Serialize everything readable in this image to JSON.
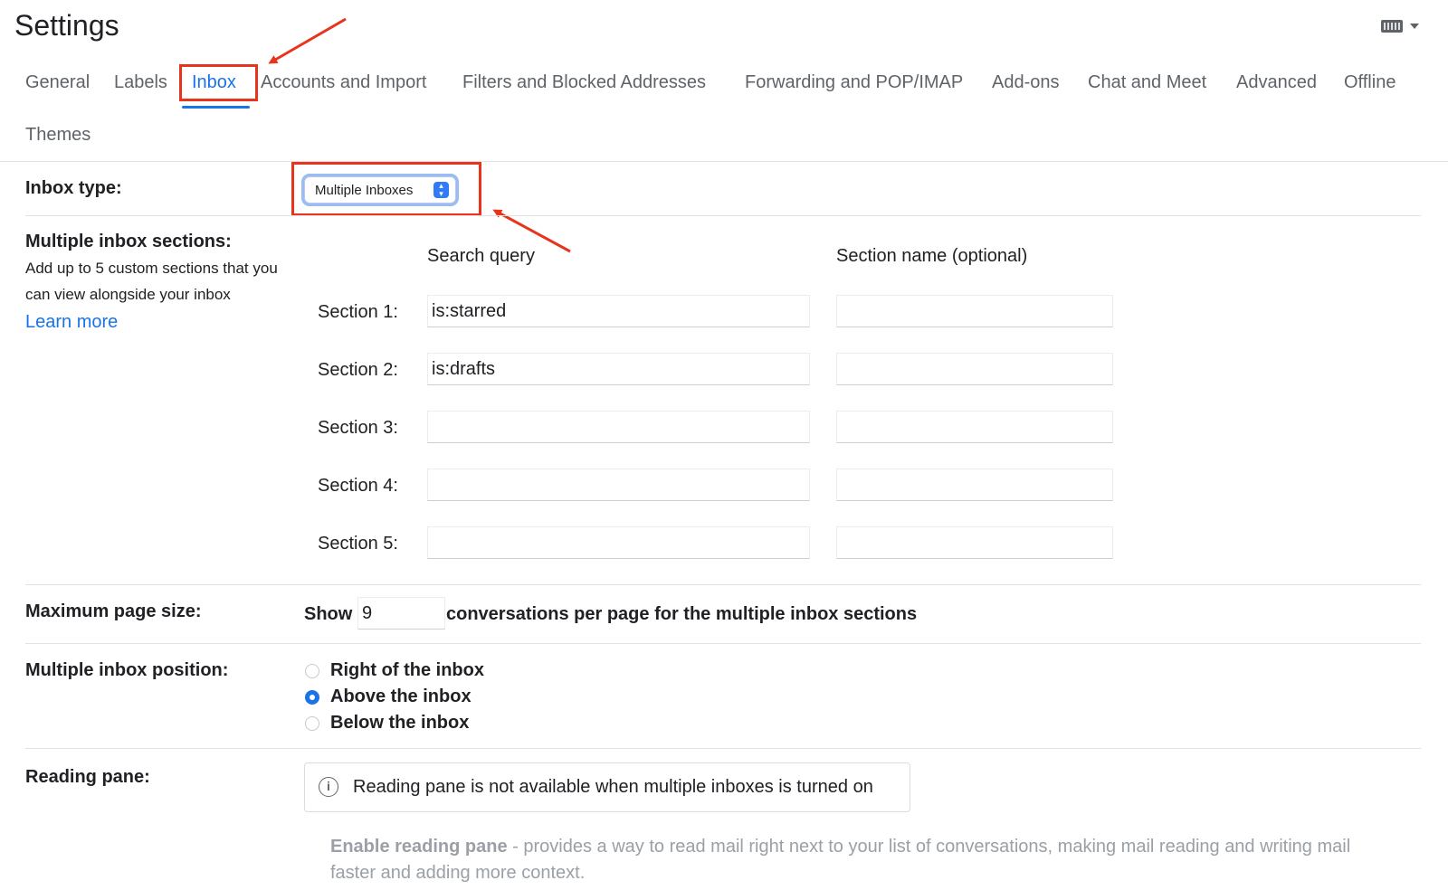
{
  "page": {
    "title": "Settings"
  },
  "keyboard": {
    "icon": "keyboard-icon"
  },
  "tabs": [
    {
      "label": "General"
    },
    {
      "label": "Labels"
    },
    {
      "label": "Inbox",
      "active": true
    },
    {
      "label": "Accounts and Import"
    },
    {
      "label": "Filters and Blocked Addresses"
    },
    {
      "label": "Forwarding and POP/IMAP"
    },
    {
      "label": "Add-ons"
    },
    {
      "label": "Chat and Meet"
    },
    {
      "label": "Advanced"
    },
    {
      "label": "Offline"
    },
    {
      "label": "Themes"
    }
  ],
  "inbox_type": {
    "label": "Inbox type:",
    "value": "Multiple Inboxes"
  },
  "multiple_sections": {
    "label": "Multiple inbox sections:",
    "desc_line1": "Add up to 5 custom sections that you",
    "desc_line2": "can view alongside your inbox",
    "learn_more": "Learn more",
    "search_header": "Search query",
    "name_header": "Section name (optional)",
    "sections": [
      {
        "label": "Section 1:",
        "query": "is:starred",
        "name": ""
      },
      {
        "label": "Section 2:",
        "query": "is:drafts",
        "name": ""
      },
      {
        "label": "Section 3:",
        "query": "",
        "name": ""
      },
      {
        "label": "Section 4:",
        "query": "",
        "name": ""
      },
      {
        "label": "Section 5:",
        "query": "",
        "name": ""
      }
    ]
  },
  "page_size": {
    "label": "Maximum page size:",
    "show": "Show",
    "value": "9",
    "suffix": "conversations per page for the multiple inbox sections"
  },
  "position": {
    "label": "Multiple inbox position:",
    "options": [
      {
        "label": "Right of the inbox",
        "selected": false
      },
      {
        "label": "Above the inbox",
        "selected": true
      },
      {
        "label": "Below the inbox",
        "selected": false
      }
    ]
  },
  "reading_pane": {
    "label": "Reading pane:",
    "notice": "Reading pane is not available when multiple inboxes is turned on",
    "enable_label": "Enable reading pane",
    "enable_desc_1": " - provides a way to read mail right next to your list of conversations, making mail reading and writing mail",
    "enable_desc_2": "faster and adding more context."
  },
  "colors": {
    "accent": "#1a73e8",
    "highlight": "#e8341c"
  }
}
